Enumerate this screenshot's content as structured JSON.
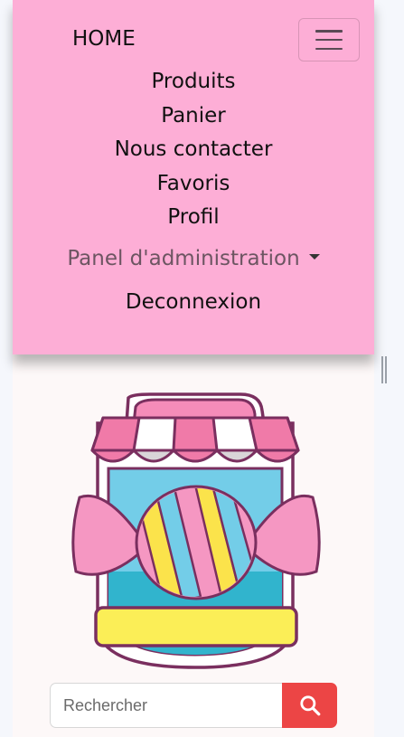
{
  "navbar": {
    "brand": "HOME",
    "items": [
      {
        "label": "Produits"
      },
      {
        "label": "Panier"
      },
      {
        "label": "Nous contacter"
      },
      {
        "label": "Favoris"
      },
      {
        "label": "Profil"
      }
    ],
    "admin_dropdown": "Panel d'administration",
    "logout": "Deconnexion",
    "toggler_icon": "hamburger-icon"
  },
  "logo": {
    "icon": "candy-shop-logo"
  },
  "search": {
    "placeholder": "Rechercher",
    "value": "",
    "button_icon": "search-icon"
  },
  "colors": {
    "navbar_bg": "#fdaed6",
    "search_button": "#ec4545",
    "page_bg": "#fdf8f8"
  }
}
